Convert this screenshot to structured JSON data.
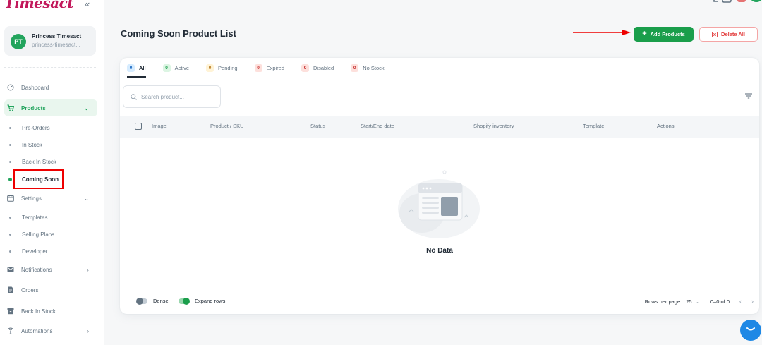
{
  "brand": "Timesact",
  "account": {
    "initials": "PT",
    "name": "Princess Timesact",
    "store": "princess-timesact..."
  },
  "sidebar": {
    "items": [
      {
        "label": "Dashboard",
        "icon": "dashboard-icon"
      },
      {
        "label": "Products",
        "icon": "cart-icon"
      },
      {
        "label": "Pre-Orders"
      },
      {
        "label": "In Stock"
      },
      {
        "label": "Back In Stock"
      },
      {
        "label": "Coming Soon"
      },
      {
        "label": "Settings",
        "icon": "calendar-icon"
      },
      {
        "label": "Templates"
      },
      {
        "label": "Selling Plans"
      },
      {
        "label": "Developer"
      },
      {
        "label": "Notifications",
        "icon": "mail-icon"
      },
      {
        "label": "Orders",
        "icon": "document-icon"
      },
      {
        "label": "Back In Stock",
        "icon": "archive-icon"
      },
      {
        "label": "Automations",
        "icon": "antenna-icon"
      }
    ]
  },
  "header": {
    "title": "Coming Soon Product List",
    "add_label": "Add Products",
    "delete_label": "Delete All"
  },
  "tabs": [
    {
      "count": "0",
      "label": "All"
    },
    {
      "count": "0",
      "label": "Active"
    },
    {
      "count": "0",
      "label": "Pending"
    },
    {
      "count": "0",
      "label": "Expired"
    },
    {
      "count": "0",
      "label": "Disabled"
    },
    {
      "count": "0",
      "label": "No Stock"
    }
  ],
  "search": {
    "placeholder": "Search product..."
  },
  "table": {
    "columns": [
      "Image",
      "Product / SKU",
      "Status",
      "Start/End date",
      "Shopify inventory",
      "Template",
      "Actions"
    ],
    "empty_text": "No Data"
  },
  "footer": {
    "dense_label": "Dense",
    "expand_label": "Expand rows",
    "rows_per_page_label": "Rows per page:",
    "rows_per_page_value": "25",
    "range": "0–0 of 0"
  },
  "colors": {
    "accent": "#1a9e4b",
    "danger": "#e23c3c",
    "highlight": "#ee0000"
  }
}
